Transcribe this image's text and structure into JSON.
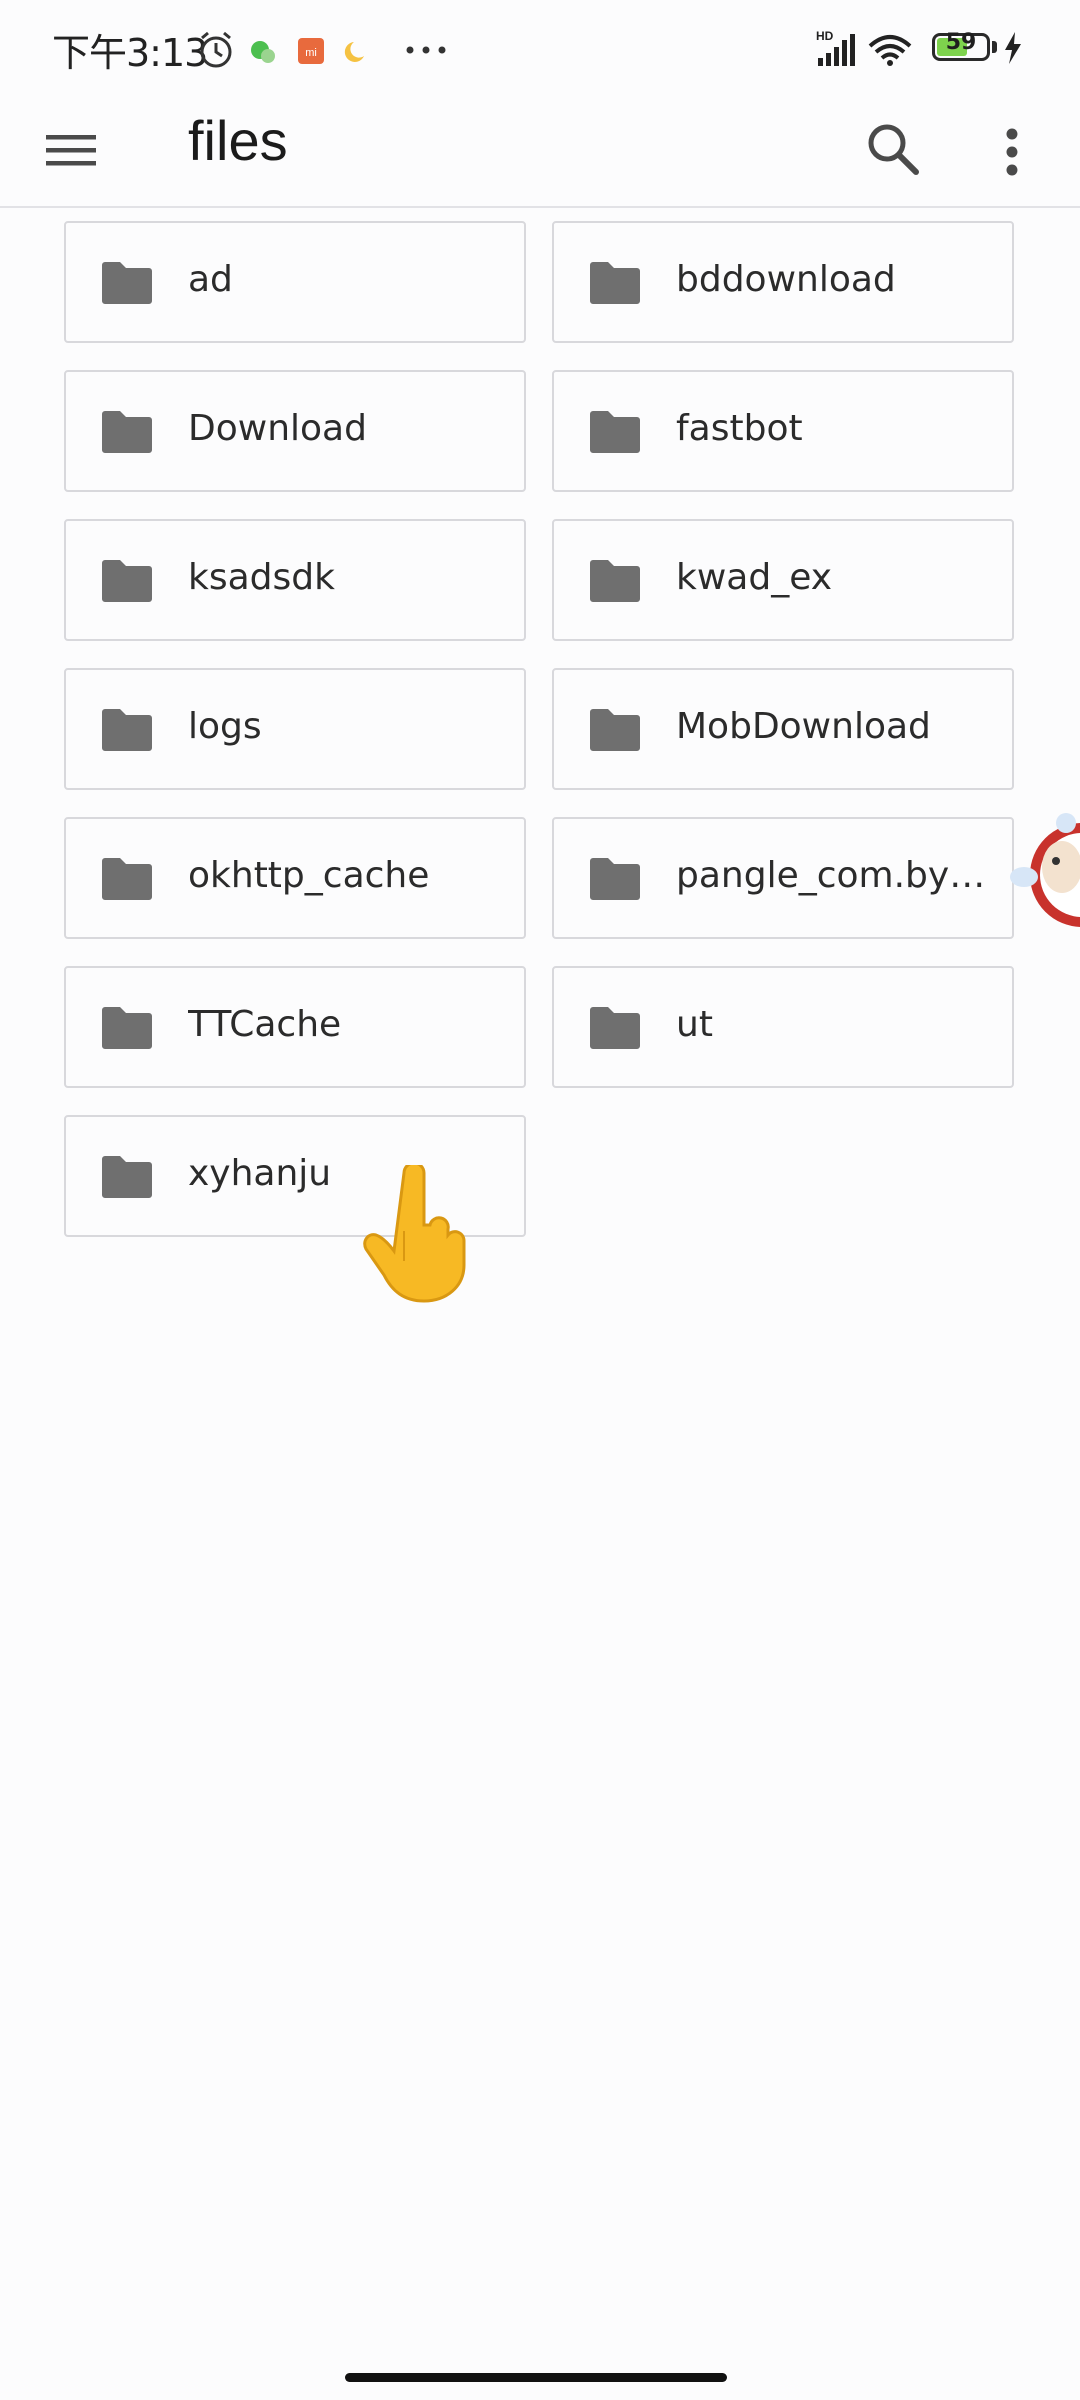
{
  "status_bar": {
    "time": "下午3:13",
    "battery_level": "59",
    "icons": [
      "alarm-icon",
      "wechat-icon",
      "mi-app-icon",
      "moon-icon",
      "more-dots-icon",
      "hd-signal-icon",
      "wifi-icon",
      "battery-icon",
      "charging-icon"
    ]
  },
  "app_bar": {
    "title": "files",
    "menu_icon": "hamburger-menu-icon",
    "search_icon": "search-icon",
    "more_icon": "more-vert-icon"
  },
  "folders": [
    {
      "name": "ad"
    },
    {
      "name": "bddownload"
    },
    {
      "name": "Download"
    },
    {
      "name": "fastbot"
    },
    {
      "name": "ksadsdk"
    },
    {
      "name": "kwad_ex"
    },
    {
      "name": "logs"
    },
    {
      "name": "MobDownload"
    },
    {
      "name": "okhttp_cache"
    },
    {
      "name": "pangle_com.byt…"
    },
    {
      "name": "TTCache"
    },
    {
      "name": "ut"
    },
    {
      "name": "xyhanju"
    }
  ],
  "colors": {
    "folder_icon": "#6f6f6f",
    "tile_border": "#d8d8dc",
    "background": "#fcfcfd",
    "battery_fill": "#7ed34d"
  }
}
